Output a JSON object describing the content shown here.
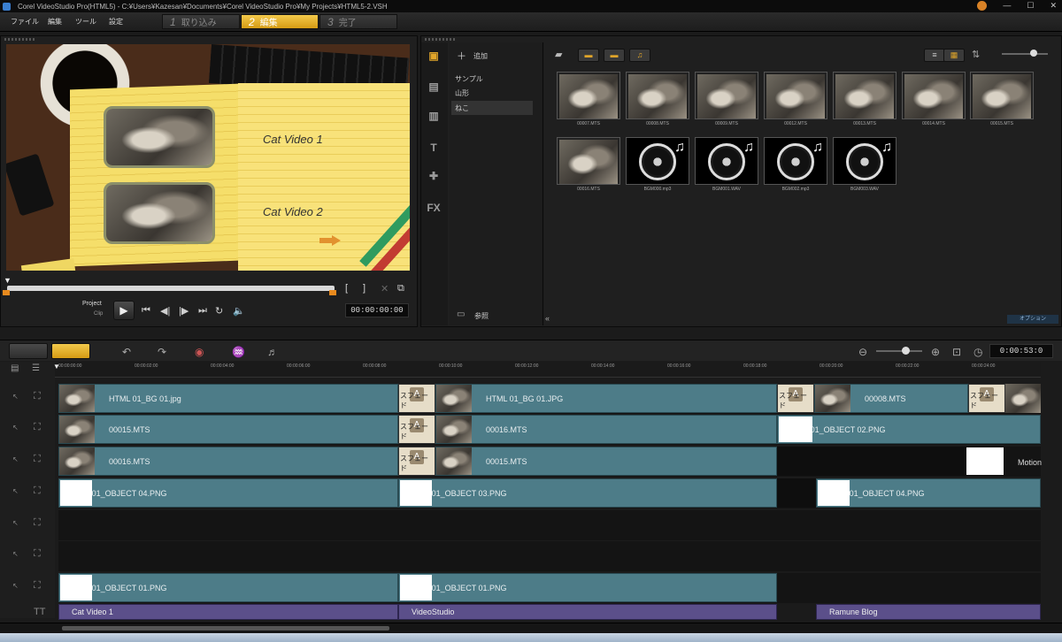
{
  "window": {
    "title": "Corel VideoStudio Pro(HTML5) - C:¥Users¥Kazesan¥Documents¥Corel VideoStudio Pro¥My Projects¥HTML5-2.VSH"
  },
  "menu": [
    "ファイル",
    "編集",
    "ツール",
    "設定"
  ],
  "steps": [
    {
      "num": "1",
      "label": "取り込み"
    },
    {
      "num": "2",
      "label": "編集"
    },
    {
      "num": "3",
      "label": "完了"
    }
  ],
  "preview": {
    "text1": "Cat Video 1",
    "text2": "Cat Video 2",
    "mode_project": "Project",
    "mode_clip": "Clip",
    "timecode": "00:00:00:00"
  },
  "library": {
    "add_label": "追加",
    "folders": [
      "サンプル",
      "山形",
      "ねこ"
    ],
    "selected_folder": "ねこ",
    "browse_label": "参照",
    "options_label": "オプション",
    "items": [
      {
        "name": "00007.MTS",
        "kind": "video"
      },
      {
        "name": "00008.MTS",
        "kind": "video"
      },
      {
        "name": "00009.MTS",
        "kind": "video"
      },
      {
        "name": "00012.MTS",
        "kind": "video"
      },
      {
        "name": "00013.MTS",
        "kind": "video"
      },
      {
        "name": "00014.MTS",
        "kind": "video"
      },
      {
        "name": "00015.MTS",
        "kind": "video"
      },
      {
        "name": "00016.MTS",
        "kind": "video"
      },
      {
        "name": "BGM000.mp3",
        "kind": "audio"
      },
      {
        "name": "BGM001.WAV",
        "kind": "audio"
      },
      {
        "name": "BGM002.mp3",
        "kind": "audio"
      },
      {
        "name": "BGM003.WAV",
        "kind": "audio"
      }
    ]
  },
  "timeline": {
    "duration": "0:00:53:0",
    "ruler": [
      "00:00:00:00",
      "00:00:02:00",
      "00:00:04:00",
      "00:00:06:00",
      "00:00:08:00",
      "00:00:10:00",
      "00:00:12:00",
      "00:00:14:00",
      "00:00:16:00",
      "00:00:18:00",
      "00:00:20:00",
      "00:00:22:00",
      "00:00:24:00"
    ],
    "transition_label": "スフェード",
    "clips": {
      "v1a": "HTML 01_BG 01.jpg",
      "v1b": "HTML 01_BG 01.JPG",
      "v1c": "00008.MTS",
      "v2a": "00015.MTS",
      "v2b": "00016.MTS",
      "v2c": "HTML 01_OBJECT 02.PNG",
      "v3a": "00016.MTS",
      "v3b": "00015.MTS",
      "v3c": "Motion",
      "v4a": "HTML 01_OBJECT 04.PNG",
      "v4b": "HTML 01_OBJECT 03.PNG",
      "v4c": "HTML 01_OBJECT 04.PNG",
      "v7a": "HTML 01_OBJECT 01.PNG",
      "v7b": "HTML 01_OBJECT 01.PNG",
      "t1": "Cat Video 1",
      "t2": "VideoStudio",
      "t3": "Ramune Blog"
    }
  }
}
